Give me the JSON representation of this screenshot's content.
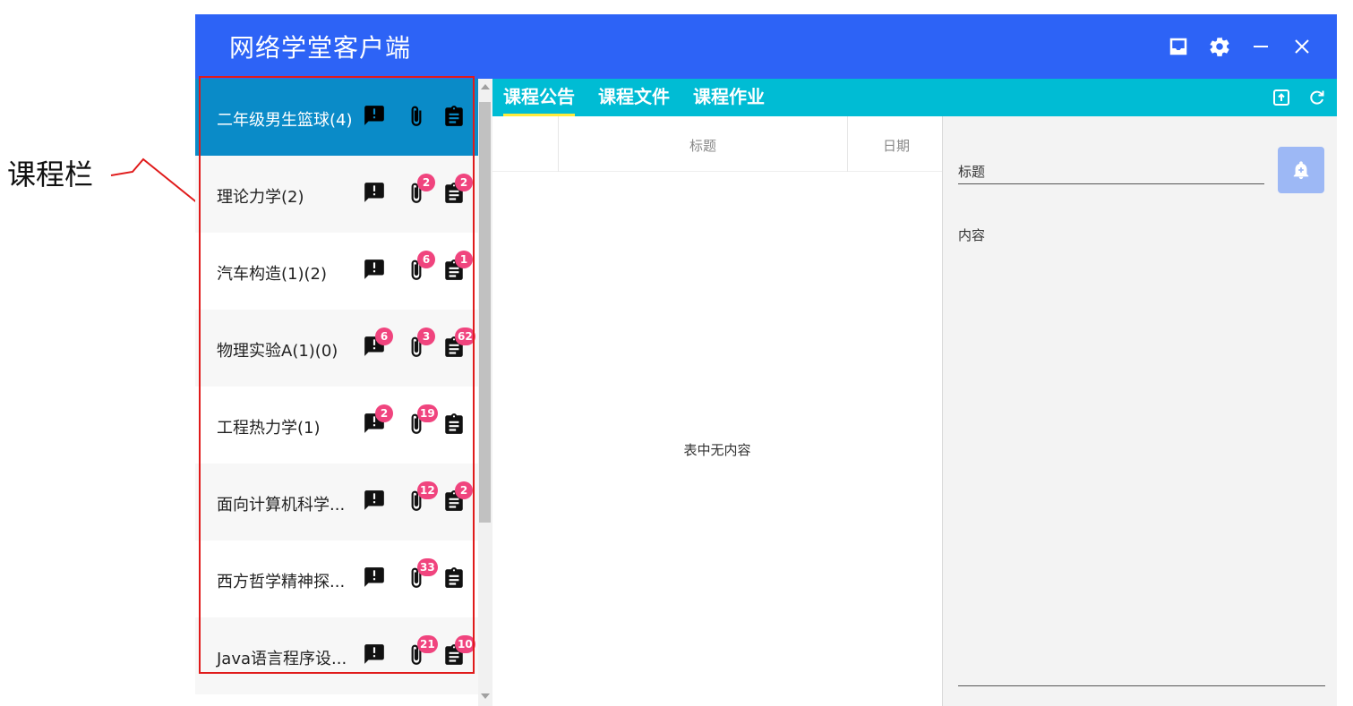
{
  "annotation": {
    "label": "课程栏"
  },
  "app": {
    "title": "网络学堂客户端",
    "window_controls": [
      "inbox-icon",
      "gear-icon",
      "minimize-icon",
      "close-icon"
    ]
  },
  "courses": [
    {
      "name": "二年级男生篮球(4)",
      "active": true,
      "announcements": null,
      "files": null,
      "homework": null
    },
    {
      "name": "理论力学(2)",
      "active": false,
      "announcements": null,
      "files": "2",
      "homework": "2"
    },
    {
      "name": "汽车构造(1)(2)",
      "active": false,
      "announcements": null,
      "files": "6",
      "homework": "1"
    },
    {
      "name": "物理实验A(1)(0)",
      "active": false,
      "announcements": "6",
      "files": "3",
      "homework": "62"
    },
    {
      "name": "工程热力学(1)",
      "active": false,
      "announcements": "2",
      "files": "19",
      "homework": null
    },
    {
      "name": "面向计算机科学...",
      "active": false,
      "announcements": null,
      "files": "12",
      "homework": "2"
    },
    {
      "name": "西方哲学精神探...",
      "active": false,
      "announcements": null,
      "files": "33",
      "homework": null
    },
    {
      "name": "Java语言程序设...",
      "active": false,
      "announcements": null,
      "files": "21",
      "homework": "10"
    }
  ],
  "tabs": [
    {
      "label": "课程公告",
      "active": true
    },
    {
      "label": "课程文件",
      "active": false
    },
    {
      "label": "课程作业",
      "active": false
    }
  ],
  "tab_actions": [
    "export-icon",
    "refresh-icon"
  ],
  "table": {
    "headers": {
      "title": "标题",
      "date": "日期"
    },
    "empty_text": "表中无内容"
  },
  "detail": {
    "title_label": "标题",
    "content_label": "内容",
    "add_button_icon": "add-notification-icon"
  },
  "colors": {
    "titlebar": "#2d63f6",
    "tabsbar": "#00bcd4",
    "active_course": "#0a8bc8",
    "badge": "#f0447e",
    "tab_indicator": "#ffeb3b",
    "annotation": "#e01b1b"
  }
}
